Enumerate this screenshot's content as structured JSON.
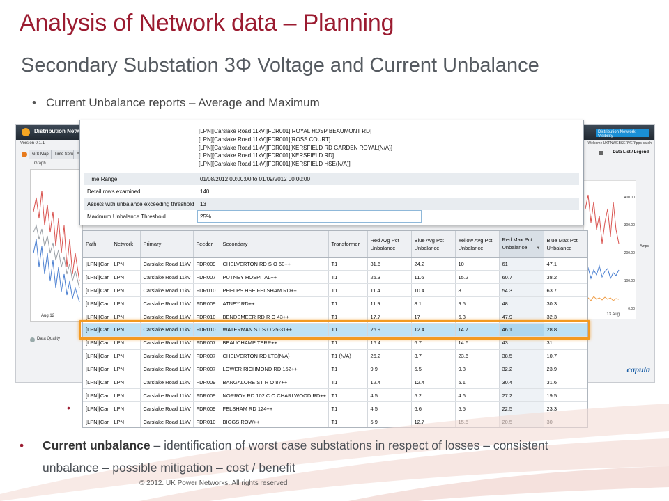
{
  "slide": {
    "title": "Analysis of Network data – Planning",
    "subtitle": "Secondary Substation 3Φ Voltage and Current Unbalance",
    "bullet_top": "Current Unbalance reports – Average and Maximum",
    "bullet_bottom_bold": "Current unbalance",
    "bullet_bottom_text": " – identification of worst case substations in respect of losses – consistent",
    "bullet_bottom_line2": "unbalance – possible mitigation – cost / benefit",
    "copyright": "© 2012. UK Power Networks. All rights reserved",
    "accent_color": "#9b1b30"
  },
  "background_app": {
    "title": "Distribution Network Visibility",
    "version": "Version 0.1.1",
    "tabs": [
      "GIS Map",
      "Time Series Data",
      "Ar"
    ],
    "graph_tab": "Graph",
    "data_quality": "Data Quality",
    "date_left": "Aug 12",
    "right_title": "Distribution Network Visibility",
    "welcome": "Welcome UKPNWEBSERVER\\pps-sarah",
    "data_list": "Data List / Legend",
    "axis_values": [
      "400.00",
      "300.00",
      "200.00",
      "100.00",
      "0.00"
    ],
    "axis_label": "Amps",
    "date_right": "13 Aug",
    "brand": "capula"
  },
  "info_panel": {
    "assets": [
      "[LPN][Carslake Road 11kV][FDR001][ROYAL HOSP BEAUMONT RD]",
      "[LPN][Carslake Road 11kV][FDR001][ROSS COURT]",
      "[LPN][Carslake Road 11kV][FDR001][KERSFIELD RD GARDEN ROYAL(N/A)]",
      "[LPN][Carslake Road 11kV][FDR001][KERSFIELD RD]",
      "[LPN][Carslake Road 11kV][FDR001][KERSFIELD HSE(N/A)]"
    ],
    "rows": [
      {
        "label": "Time Range",
        "value": "01/08/2012 00:00:00 to 01/09/2012 00:00:00"
      },
      {
        "label": "Detail rows examined",
        "value": "140"
      },
      {
        "label": "Assets with unbalance exceeding threshold",
        "value": "13"
      },
      {
        "label": "Maximum Unbalance Threshold",
        "value": "25%"
      }
    ]
  },
  "table": {
    "columns": [
      "Path",
      "Network",
      "Primary",
      "Feeder",
      "Secondary",
      "Transformer",
      "Red Avg Pct Unbalance",
      "Blue Avg Pct Unbalance",
      "Yellow Avg Pct Unbalance",
      "Red Max Pct Unbalance",
      "Blue Max Pct Unbalance"
    ],
    "sorted_column": 9,
    "selected_row": 5,
    "rows": [
      [
        "[LPN][Car",
        "LPN",
        "Carslake Road 11kV",
        "FDR009",
        "CHELVERTON RD S O 60++",
        "T1",
        "31.6",
        "24.2",
        "10",
        "61",
        "47.1"
      ],
      [
        "[LPN][Car",
        "LPN",
        "Carslake Road 11kV",
        "FDR007",
        "PUTNEY HOSPITAL++",
        "T1",
        "25.3",
        "11.6",
        "15.2",
        "60.7",
        "38.2"
      ],
      [
        "[LPN][Car",
        "LPN",
        "Carslake Road 11kV",
        "FDR010",
        "PHELPS HSE FELSHAM RD++",
        "T1",
        "11.4",
        "10.4",
        "8",
        "54.3",
        "63.7"
      ],
      [
        "[LPN][Car",
        "LPN",
        "Carslake Road 11kV",
        "FDR009",
        "ATNEY RD++",
        "T1",
        "11.9",
        "8.1",
        "9.5",
        "48",
        "30.3"
      ],
      [
        "[LPN][Car",
        "LPN",
        "Carslake Road 11kV",
        "FDR010",
        "BENDEMEER RD R O 43++",
        "T1",
        "17.7",
        "17",
        "6.3",
        "47.9",
        "32.3"
      ],
      [
        "[LPN][Car",
        "LPN",
        "Carslake Road 11kV",
        "FDR010",
        "WATERMAN ST S O 25-31++",
        "T1",
        "26.9",
        "12.4",
        "14.7",
        "46.1",
        "28.8"
      ],
      [
        "[LPN][Car",
        "LPN",
        "Carslake Road 11kV",
        "FDR007",
        "BEAUCHAMP TERR++",
        "T1",
        "16.4",
        "6.7",
        "14.6",
        "43",
        "31"
      ],
      [
        "[LPN][Car",
        "LPN",
        "Carslake Road 11kV",
        "FDR007",
        "CHELVERTON RD LTE(N/A)",
        "T1 (N/A)",
        "26.2",
        "3.7",
        "23.6",
        "38.5",
        "10.7"
      ],
      [
        "[LPN][Car",
        "LPN",
        "Carslake Road 11kV",
        "FDR007",
        "LOWER RICHMOND RD 152++",
        "T1",
        "9.9",
        "5.5",
        "9.8",
        "32.2",
        "23.9"
      ],
      [
        "[LPN][Car",
        "LPN",
        "Carslake Road 11kV",
        "FDR009",
        "BANGALORE ST R O 87++",
        "T1",
        "12.4",
        "12.4",
        "5.1",
        "30.4",
        "31.6"
      ],
      [
        "[LPN][Car",
        "LPN",
        "Carslake Road 11kV",
        "FDR009",
        "NORROY RD 102 C O CHARLWOOD RD++",
        "T1",
        "4.5",
        "5.2",
        "4.6",
        "27.2",
        "19.5"
      ],
      [
        "[LPN][Car",
        "LPN",
        "Carslake Road 11kV",
        "FDR009",
        "FELSHAM RD 124++",
        "T1",
        "4.5",
        "6.6",
        "5.5",
        "22.5",
        "23.3"
      ],
      [
        "[LPN][Car",
        "LPN",
        "Carslake Road 11kV",
        "FDR010",
        "BIGGS ROW++",
        "T1",
        "5.9",
        "12.7",
        "15.5",
        "20.5",
        "30"
      ]
    ]
  }
}
